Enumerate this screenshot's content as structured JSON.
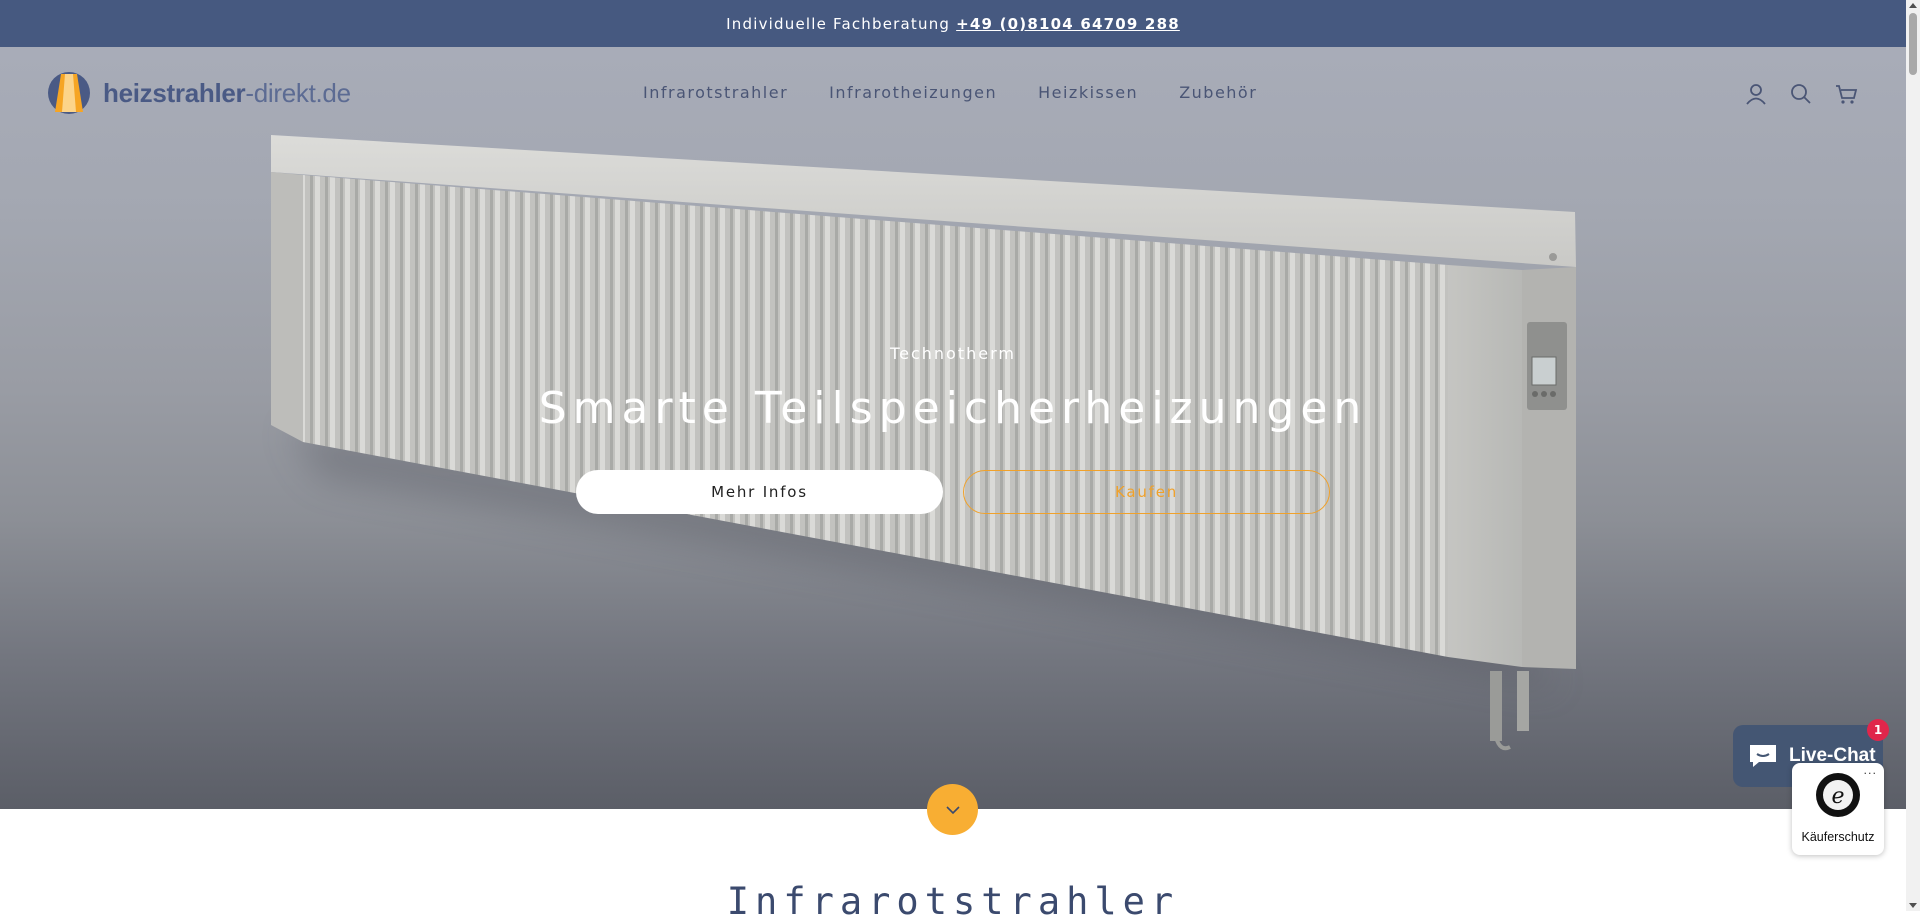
{
  "announcement": {
    "text": "Individuelle Fachberatung",
    "phone": "+49 (0)8104 64709 288"
  },
  "header": {
    "logo_bold": "heizstrahler",
    "logo_light": "-direkt.de",
    "nav": [
      "Infrarotstrahler",
      "Infrarotheizungen",
      "Heizkissen",
      "Zubehör"
    ],
    "icons": [
      "account-icon",
      "search-icon",
      "cart-icon"
    ]
  },
  "hero": {
    "subtitle": "Technotherm",
    "title": "Smarte Teilspeicherheizungen",
    "primary_button": "Mehr Infos",
    "secondary_button": "Kaufen"
  },
  "section": {
    "title": "Infrarotstrahler"
  },
  "widgets": {
    "livechat_label": "Live-Chat",
    "livechat_badge": "1",
    "trust_menu": "...",
    "trust_label": "Käuferschutz"
  },
  "colors": {
    "announcement_bg": "#465980",
    "accent": "#f8ae33",
    "outline_button": "#f0a12a",
    "nav_text": "#4a5575"
  }
}
